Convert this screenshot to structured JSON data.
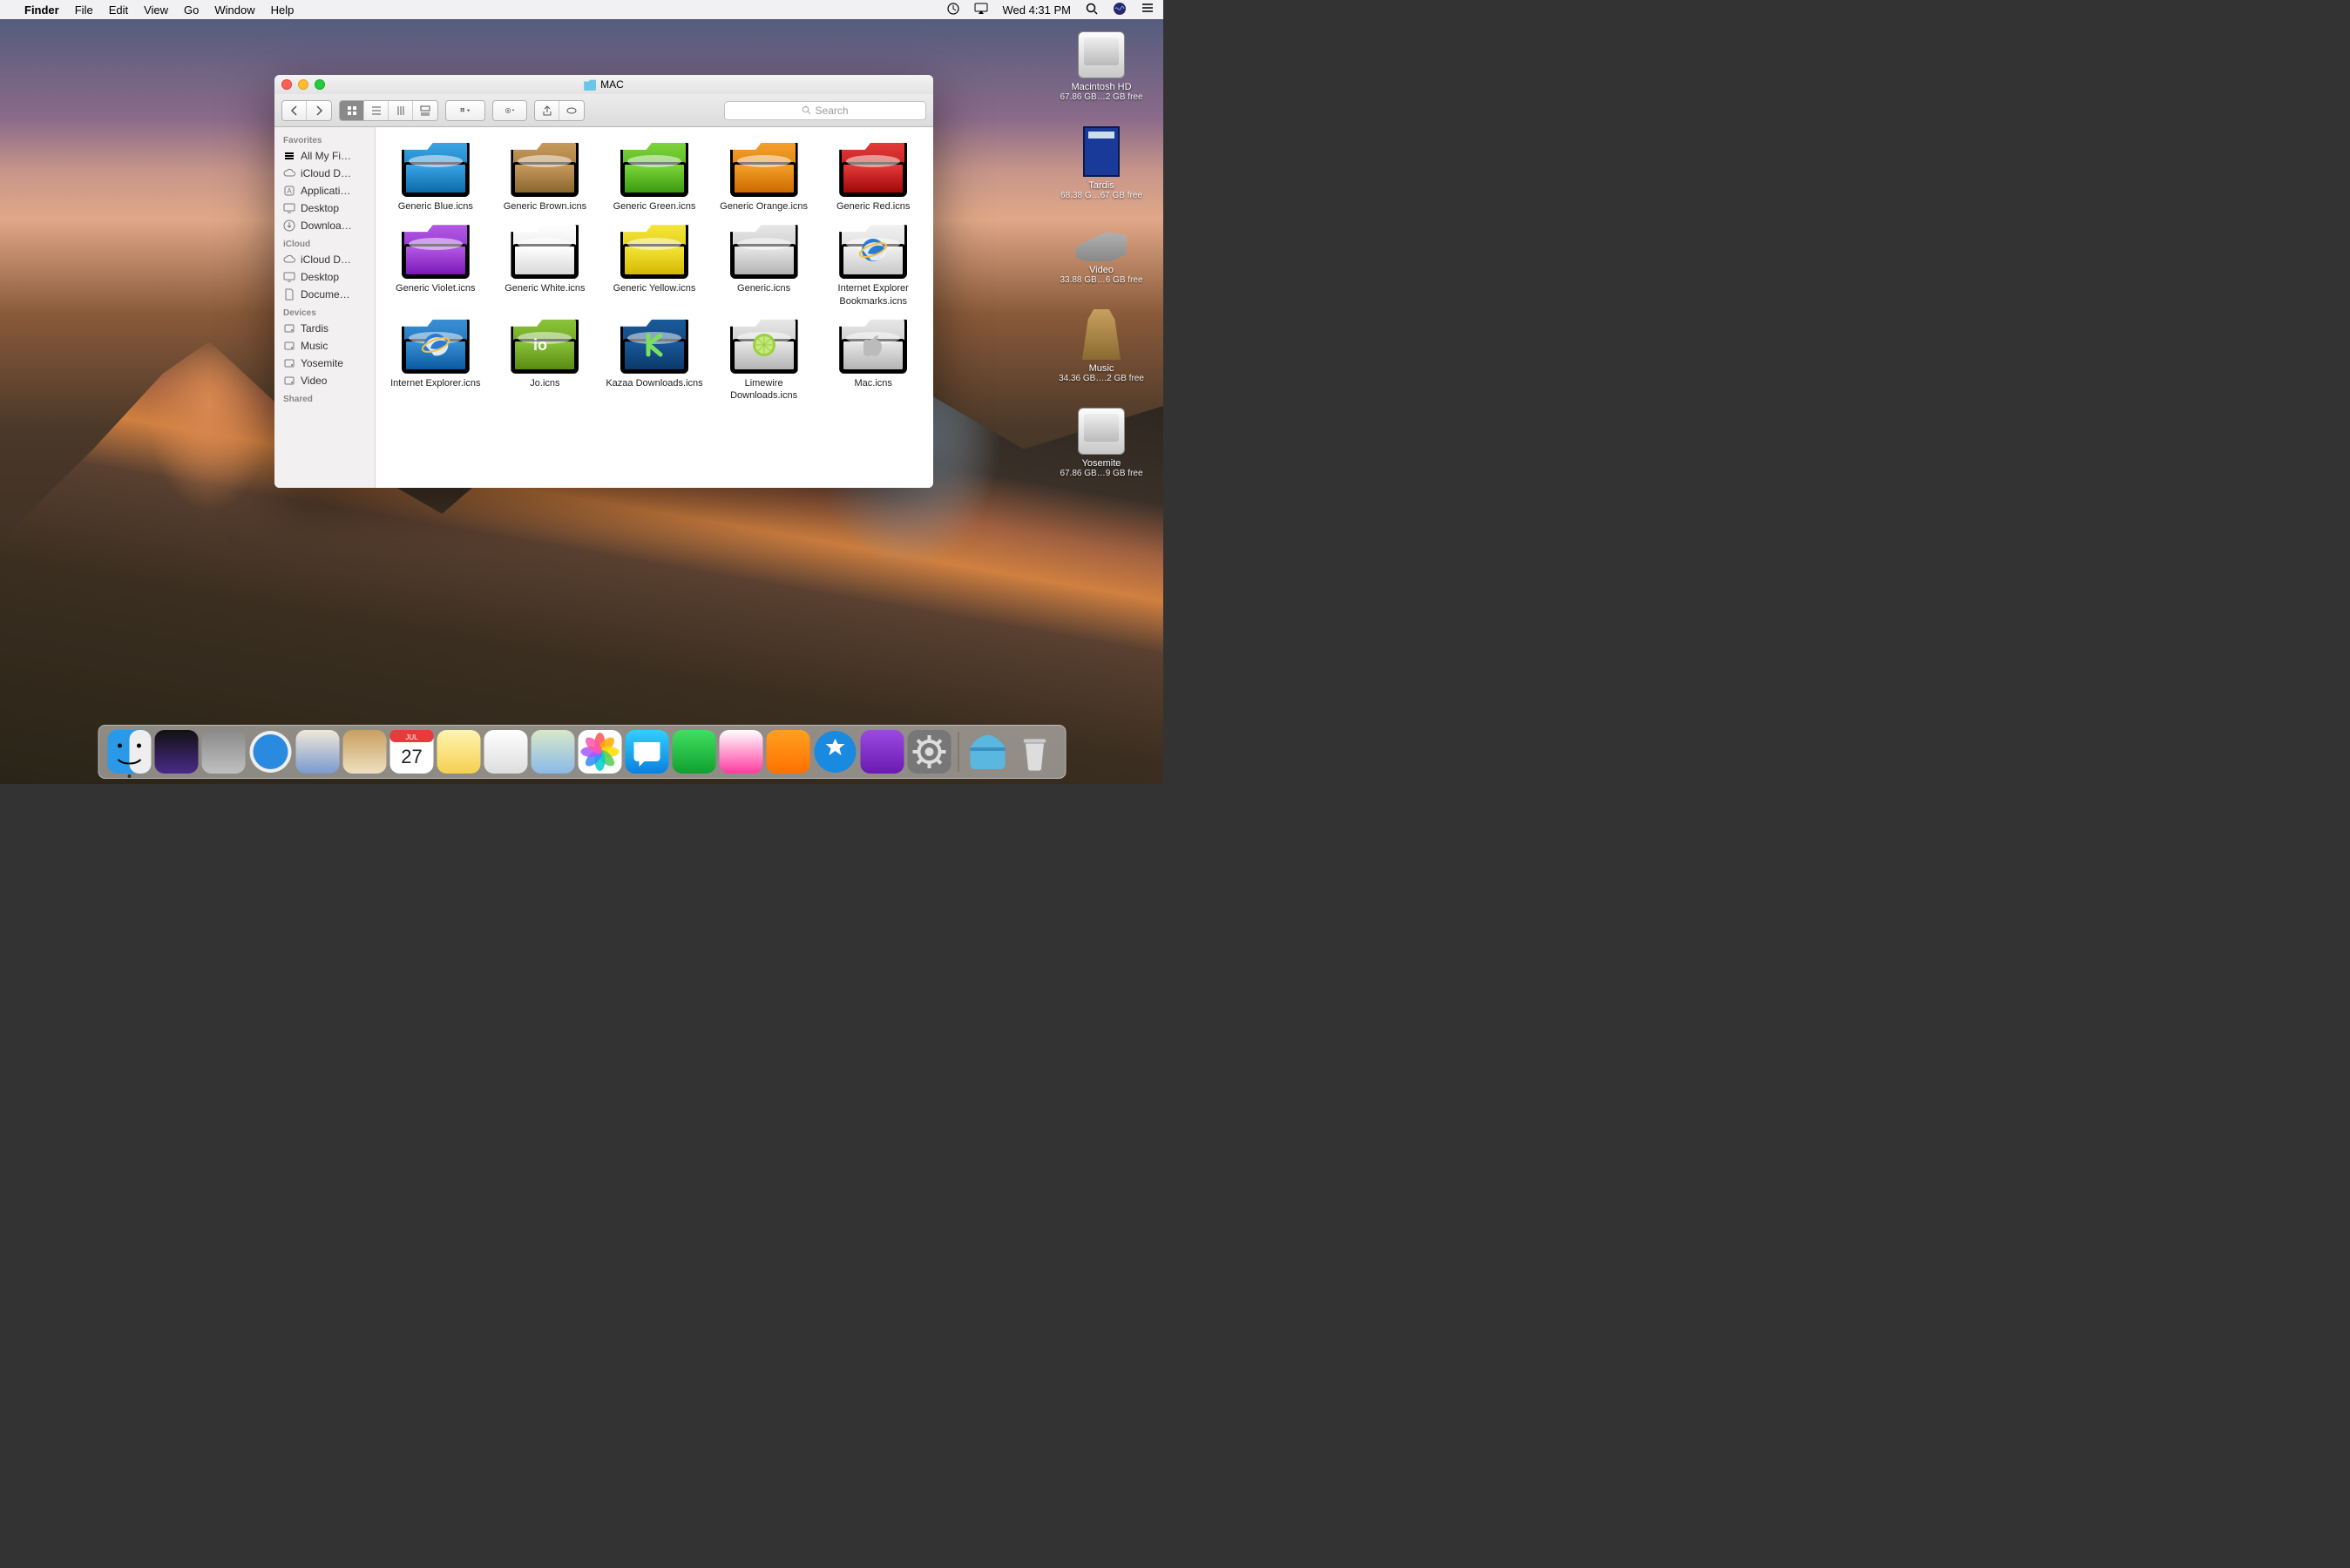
{
  "menubar": {
    "app_name": "Finder",
    "menus": [
      "File",
      "Edit",
      "View",
      "Go",
      "Window",
      "Help"
    ],
    "clock": "Wed 4:31 PM"
  },
  "desktop_drives": [
    {
      "name": "Macintosh HD",
      "sub": "67.86 GB…2 GB free",
      "kind": "drive"
    },
    {
      "name": "Tardis",
      "sub": "68.38 G…67 GB free",
      "kind": "tardis"
    },
    {
      "name": "Video",
      "sub": "33.88 GB…6 GB free",
      "kind": "k9"
    },
    {
      "name": "Music",
      "sub": "34.36 GB….2 GB free",
      "kind": "dalek"
    },
    {
      "name": "Yosemite",
      "sub": "67.86 GB…9 GB free",
      "kind": "drive"
    }
  ],
  "finder": {
    "title": "MAC",
    "search_placeholder": "Search",
    "sidebar": {
      "sections": [
        {
          "head": "Favorites",
          "items": [
            {
              "label": "All My Fi…",
              "icon": "stack"
            },
            {
              "label": "iCloud D…",
              "icon": "cloud"
            },
            {
              "label": "Applicati…",
              "icon": "app"
            },
            {
              "label": "Desktop",
              "icon": "desktop"
            },
            {
              "label": "Downloa…",
              "icon": "download"
            }
          ]
        },
        {
          "head": "iCloud",
          "items": [
            {
              "label": "iCloud D…",
              "icon": "cloud"
            },
            {
              "label": "Desktop",
              "icon": "desktop"
            },
            {
              "label": "Docume…",
              "icon": "doc"
            }
          ]
        },
        {
          "head": "Devices",
          "items": [
            {
              "label": "Tardis",
              "icon": "disk"
            },
            {
              "label": "Music",
              "icon": "disk"
            },
            {
              "label": "Yosemite",
              "icon": "disk"
            },
            {
              "label": "Video",
              "icon": "disk"
            }
          ]
        },
        {
          "head": "Shared",
          "items": []
        }
      ]
    },
    "files": [
      {
        "label": "Generic Blue.icns",
        "fill1": "#3aa5e6",
        "fill2": "#0b6aa8"
      },
      {
        "label": "Generic Brown.icns",
        "fill1": "#c89a5a",
        "fill2": "#8a6630"
      },
      {
        "label": "Generic Green.icns",
        "fill1": "#7ed63a",
        "fill2": "#3a9a10"
      },
      {
        "label": "Generic Orange.icns",
        "fill1": "#f5a02a",
        "fill2": "#cc6a00"
      },
      {
        "label": "Generic Red.icns",
        "fill1": "#e63a3a",
        "fill2": "#a00808"
      },
      {
        "label": "Generic Violet.icns",
        "fill1": "#b45ae6",
        "fill2": "#7a18b8"
      },
      {
        "label": "Generic White.icns",
        "fill1": "#ffffff",
        "fill2": "#d8d8d8"
      },
      {
        "label": "Generic Yellow.icns",
        "fill1": "#f5e63a",
        "fill2": "#d4b800"
      },
      {
        "label": "Generic.icns",
        "fill1": "#e8e8e8",
        "fill2": "#b4b4b4"
      },
      {
        "label": "Internet Explorer Bookmarks.icns",
        "fill1": "#f2f2f2",
        "fill2": "#c8c8c8",
        "overlay": "ie"
      },
      {
        "label": "Internet Explorer.icns",
        "fill1": "#3a90d6",
        "fill2": "#0a5aa0",
        "overlay": "ie"
      },
      {
        "label": "Jo.icns",
        "fill1": "#8ac43a",
        "fill2": "#5a8a10",
        "overlay": "jo"
      },
      {
        "label": "Kazaa Downloads.icns",
        "fill1": "#1a5a9a",
        "fill2": "#0a3a6a",
        "overlay": "k"
      },
      {
        "label": "Limewire Downloads.icns",
        "fill1": "#e8e8e8",
        "fill2": "#b4b4b4",
        "overlay": "lime"
      },
      {
        "label": "Mac.icns",
        "fill1": "#e8e8e8",
        "fill2": "#b4b4b4",
        "overlay": "apple"
      }
    ]
  },
  "dock": [
    {
      "name": "finder",
      "color1": "#38a0f2",
      "color2": "#ededed",
      "running": true
    },
    {
      "name": "siri",
      "color1": "#111",
      "color2": "#4a2a8a"
    },
    {
      "name": "launchpad",
      "color1": "#8a8a8a",
      "color2": "#c0c0c0"
    },
    {
      "name": "safari",
      "color1": "#2a8ae0",
      "color2": "#eee"
    },
    {
      "name": "mail",
      "color1": "#efe8d8",
      "color2": "#7a9ad0"
    },
    {
      "name": "contacts",
      "color1": "#c8a060",
      "color2": "#efe0c0"
    },
    {
      "name": "calendar",
      "color1": "#fff",
      "color2": "#e83a3a",
      "text": "27"
    },
    {
      "name": "notes",
      "color1": "#fff4b0",
      "color2": "#f5d050"
    },
    {
      "name": "reminders",
      "color1": "#fff",
      "color2": "#ddd"
    },
    {
      "name": "maps",
      "color1": "#d8e8c8",
      "color2": "#8abae8"
    },
    {
      "name": "photos",
      "color1": "#fff",
      "color2": "#fff",
      "flower": true
    },
    {
      "name": "messages",
      "color1": "#30d0ff",
      "color2": "#0a80e0"
    },
    {
      "name": "facetime",
      "color1": "#40e060",
      "color2": "#10a030"
    },
    {
      "name": "itunes",
      "color1": "#fff",
      "color2": "#ff3aa0"
    },
    {
      "name": "ibooks",
      "color1": "#ffa020",
      "color2": "#ff7000"
    },
    {
      "name": "appstore",
      "color1": "#30b0f0",
      "color2": "#0a6ad0"
    },
    {
      "name": "feedback",
      "color1": "#9a4ae0",
      "color2": "#6a1ab0"
    },
    {
      "name": "preferences",
      "color1": "#888",
      "color2": "#444"
    }
  ],
  "dock_right": [
    {
      "name": "downloads",
      "color1": "#6ac5e8",
      "color2": "#3a9ad0"
    },
    {
      "name": "trash",
      "color1": "#e0e0e0",
      "color2": "#b0b0b0"
    }
  ]
}
